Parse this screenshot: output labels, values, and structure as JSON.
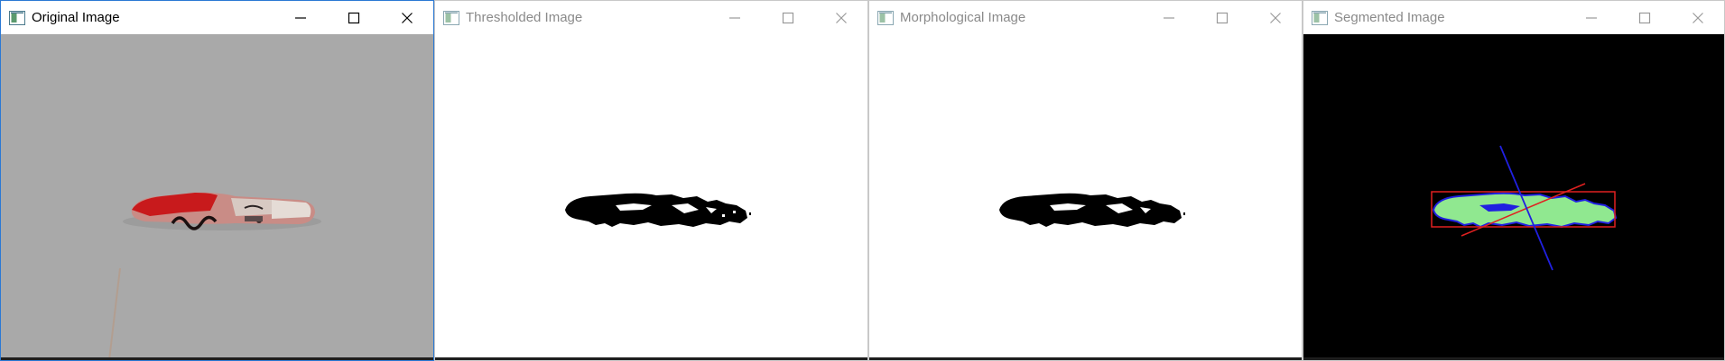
{
  "windows": [
    {
      "title": "Original Image",
      "active": true,
      "controls": {
        "minimize": "minimize-icon",
        "maximize": "maximize-icon",
        "close": "close-icon"
      }
    },
    {
      "title": "Thresholded Image",
      "active": false,
      "controls": {
        "minimize": "minimize-icon",
        "maximize": "maximize-icon",
        "close": "close-icon"
      }
    },
    {
      "title": "Morphological Image",
      "active": false,
      "controls": {
        "minimize": "minimize-icon",
        "maximize": "maximize-icon",
        "close": "close-icon"
      }
    },
    {
      "title": "Segmented Image",
      "active": false,
      "controls": {
        "minimize": "minimize-icon",
        "maximize": "maximize-icon",
        "close": "close-icon"
      }
    }
  ],
  "segmented": {
    "overlay_label": "",
    "colors": {
      "background": "#000000",
      "mask": "#90e890",
      "contour": "#2020e0",
      "bbox": "#e02020",
      "major_axis": "#e02020",
      "minor_axis": "#2020e0"
    }
  },
  "colors": {
    "original_bg": "#aaaaaa",
    "threshold_bg": "#ffffff",
    "blob": "#000000",
    "active_border": "#2b79d4"
  }
}
